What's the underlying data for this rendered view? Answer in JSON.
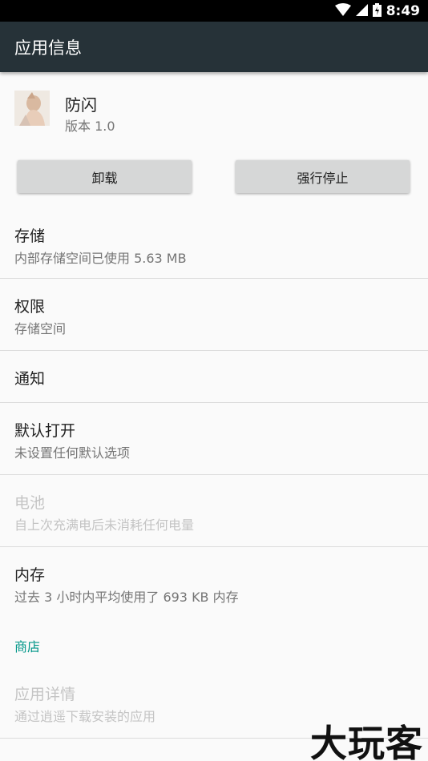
{
  "status_bar": {
    "time": "8:49",
    "icons": [
      "wifi-icon",
      "signal-icon",
      "battery-charging-icon"
    ]
  },
  "app_bar": {
    "title": "应用信息"
  },
  "app": {
    "name": "防闪",
    "version": "版本 1.0"
  },
  "buttons": {
    "uninstall": "卸载",
    "force_stop": "强行停止"
  },
  "items": {
    "storage": {
      "title": "存储",
      "subtitle": "内部存储空间已使用 5.63 MB"
    },
    "permissions": {
      "title": "权限",
      "subtitle": "存储空间"
    },
    "notifications": {
      "title": "通知"
    },
    "open_by_default": {
      "title": "默认打开",
      "subtitle": "未设置任何默认选项"
    },
    "battery": {
      "title": "电池",
      "subtitle": "自上次充满电后未消耗任何电量"
    },
    "memory": {
      "title": "内存",
      "subtitle": "过去 3 小时内平均使用了 693 KB 内存"
    }
  },
  "store": {
    "header": "商店",
    "app_details": {
      "title": "应用详情",
      "subtitle": "通过逍遥下载安装的应用"
    }
  },
  "watermark": "大玩客",
  "colors": {
    "app_bar": "#263238",
    "status_bar": "#000000",
    "accent": "#009688",
    "button": "#d6d7d7"
  }
}
